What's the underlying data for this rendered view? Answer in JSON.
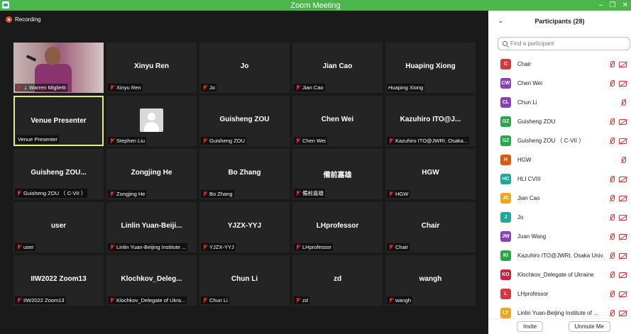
{
  "window": {
    "title": "Zoom Meeting",
    "controls": [
      "–",
      "❐",
      "✕"
    ]
  },
  "recording": {
    "label": "Recording"
  },
  "tiles": [
    {
      "name": "",
      "label": "Warren Miglietti",
      "muted": true,
      "pinned": true,
      "photo": true
    },
    {
      "name": "Xinyu Ren",
      "label": "Xinyu Ren",
      "muted": true
    },
    {
      "name": "Jo",
      "label": "Jo",
      "muted": true
    },
    {
      "name": "Jian Cao",
      "label": "Jian Cao",
      "muted": true
    },
    {
      "name": "Huaping Xiong",
      "label": "Huaping Xiong",
      "muted": false
    },
    {
      "name": "Venue Presenter",
      "label": "Venue Presenter",
      "muted": false,
      "active": true
    },
    {
      "name": "",
      "label": "Stephen Liu",
      "muted": true,
      "avatar": true
    },
    {
      "name": "Guisheng ZOU",
      "label": "Guisheng ZOU",
      "muted": true
    },
    {
      "name": "Chen Wei",
      "label": "Chen Wei",
      "muted": true
    },
    {
      "name": "Kazuhiro ITO@J...",
      "label": "Kazuhiro ITO@JWRI, Osaka...",
      "muted": true
    },
    {
      "name": "Guisheng ZOU...",
      "label": "Guisheng ZOU （ C-VII ）",
      "muted": true
    },
    {
      "name": "Zongjing He",
      "label": "Zongjing He",
      "muted": true
    },
    {
      "name": "Bo Zhang",
      "label": "Bo Zhang",
      "muted": true
    },
    {
      "name": "備前嘉雄",
      "label": "備前嘉雄",
      "muted": true
    },
    {
      "name": "HGW",
      "label": "HGW",
      "muted": true
    },
    {
      "name": "user",
      "label": "user",
      "muted": true
    },
    {
      "name": "Linlin Yuan-Beiji...",
      "label": "Linlin Yuan-Beijing Institute ...",
      "muted": true
    },
    {
      "name": "YJZX-YYJ",
      "label": "YJZX-YYJ",
      "muted": true
    },
    {
      "name": "LHprofessor",
      "label": "LHprofessor",
      "muted": true
    },
    {
      "name": "Chair",
      "label": "Chair",
      "muted": true
    },
    {
      "name": "IIW2022 Zoom13",
      "label": "IIW2022 Zoom13",
      "muted": true
    },
    {
      "name": "Klochkov_Deleg...",
      "label": "Klochkov_Delegate of Ukra...",
      "muted": true
    },
    {
      "name": "Chun Li",
      "label": "Chun Li",
      "muted": true
    },
    {
      "name": "zd",
      "label": "zd",
      "muted": true
    },
    {
      "name": "wangh",
      "label": "wangh",
      "muted": true
    }
  ],
  "panel": {
    "title": "Participants (28)",
    "search_placeholder": "Find a participant",
    "participants": [
      {
        "initials": "C",
        "name": "Chair",
        "color": "#d9363e",
        "mic": true,
        "cam": true
      },
      {
        "initials": "CW",
        "name": "Chen Wei",
        "color": "#8a3fc1",
        "mic": true,
        "cam": true
      },
      {
        "initials": "CL",
        "name": "Chun Li",
        "color": "#8a3fc1",
        "mic": true,
        "cam": false
      },
      {
        "initials": "GZ",
        "name": "Guisheng ZOU",
        "color": "#27a844",
        "mic": true,
        "cam": true
      },
      {
        "initials": "GZ",
        "name": "Guisheng ZOU （ C-VII ）",
        "color": "#27a844",
        "mic": true,
        "cam": true
      },
      {
        "initials": "H",
        "name": "HGW",
        "color": "#e0580f",
        "mic": true,
        "cam": false
      },
      {
        "initials": "HC",
        "name": "HLI CVIII",
        "color": "#1ba99b",
        "mic": true,
        "cam": true
      },
      {
        "initials": "JC",
        "name": "Jian Cao",
        "color": "#f2a421",
        "mic": true,
        "cam": true
      },
      {
        "initials": "J",
        "name": "Jo",
        "color": "#1ba99b",
        "mic": true,
        "cam": true
      },
      {
        "initials": "JW",
        "name": "Juan Wang",
        "color": "#8a3fc1",
        "mic": true,
        "cam": true
      },
      {
        "initials": "KI",
        "name": "Kazuhiro ITO@JWRI, Osaka Univ.",
        "color": "#27a844",
        "mic": true,
        "cam": true
      },
      {
        "initials": "KO",
        "name": "Klochkov_Delegate of Ukraine",
        "color": "#c8243b",
        "mic": true,
        "cam": true
      },
      {
        "initials": "L",
        "name": "LHprofessor",
        "color": "#d9363e",
        "mic": true,
        "cam": true
      },
      {
        "initials": "LY",
        "name": "Linlin Yuan-Beijing Institute of ...",
        "color": "#f2a421",
        "mic": true,
        "cam": true
      }
    ],
    "invite_label": "Invite",
    "unmute_label": "Unmute Me"
  }
}
